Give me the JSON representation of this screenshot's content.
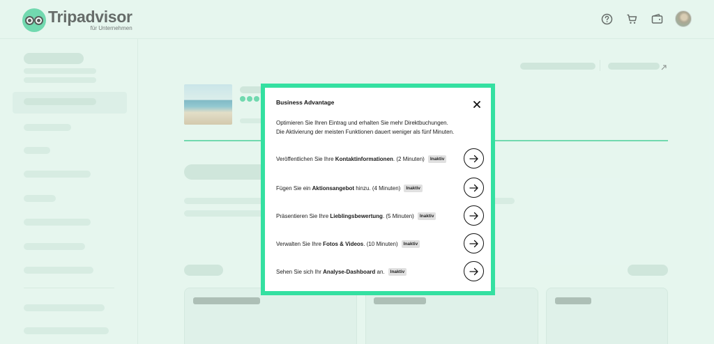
{
  "header": {
    "brand": "Tripadvisor",
    "brand_sub": "für Unternehmen",
    "icons": [
      "help-icon",
      "cart-icon",
      "wallet-icon"
    ]
  },
  "colors": {
    "accent": "#34e0a1",
    "background": "#e6f6ef",
    "brand_green": "#34c98e"
  },
  "modal": {
    "title": "Business Advantage",
    "intro_line1": "Optimieren Sie Ihren Eintrag und erhalten Sie mehr Direktbuchungen.",
    "intro_line2": "Die Aktivierung der meisten Funktionen dauert weniger als fünf Minuten.",
    "items": [
      {
        "pre": "Veröffentlichen Sie Ihre ",
        "bold": "Kontaktinformationen",
        "post": ". (2 Minuten)",
        "status": "Inaktiv"
      },
      {
        "pre": "Fügen Sie ein ",
        "bold": "Aktionsangebot",
        "post": " hinzu. (4 Minuten)",
        "status": "Inaktiv"
      },
      {
        "pre": "Präsentieren Sie Ihre ",
        "bold": "Lieblingsbewertung",
        "post": ". (5 Minuten)",
        "status": "Inaktiv"
      },
      {
        "pre": "Verwalten Sie Ihre ",
        "bold": "Fotos & Videos",
        "post": ". (10 Minuten)",
        "status": "Inaktiv"
      },
      {
        "pre": "Sehen Sie sich Ihr ",
        "bold": "Analyse-Dashboard",
        "post": " an.",
        "status": "Inaktiv"
      }
    ]
  }
}
